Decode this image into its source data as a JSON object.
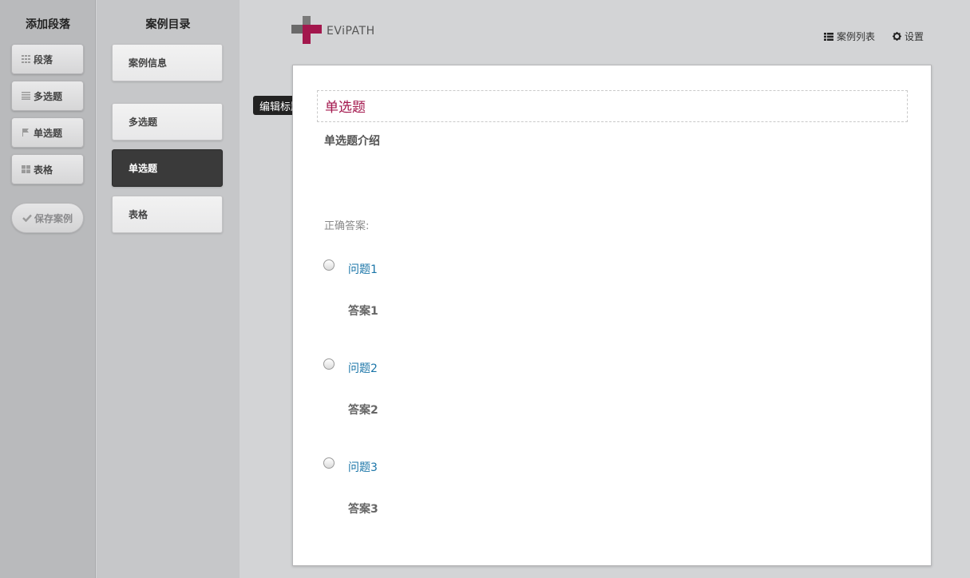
{
  "sidebar_add": {
    "title": "添加段落",
    "buttons": [
      {
        "label": "段落",
        "icon": "grid-icon"
      },
      {
        "label": "多选题",
        "icon": "list-icon"
      },
      {
        "label": "单选题",
        "icon": "flag-icon"
      },
      {
        "label": "表格",
        "icon": "table-icon"
      }
    ],
    "save_label": "保存案例",
    "save_icon": "check-icon"
  },
  "catalog": {
    "title": "案例目录",
    "items": [
      {
        "label": "案例信息",
        "active": false
      },
      {
        "label": "多选题",
        "active": false
      },
      {
        "label": "单选题",
        "active": true
      },
      {
        "label": "表格",
        "active": false
      }
    ]
  },
  "header": {
    "brand": "EViPATH",
    "nav": [
      {
        "label": "案例列表",
        "icon": "list-icon"
      },
      {
        "label": "设置",
        "icon": "gear-icon"
      }
    ]
  },
  "editor": {
    "tooltip": "编辑标题",
    "title": "单选题",
    "intro": "单选题介绍",
    "answer_label": "正确答案:",
    "questions": [
      {
        "question": "问题1",
        "answer": "答案1"
      },
      {
        "question": "问题2",
        "answer": "答案2"
      },
      {
        "question": "问题3",
        "answer": "答案3"
      }
    ]
  },
  "colors": {
    "title_accent": "#a3174d",
    "question_link": "#1a75a8",
    "active_item_bg": "#3a3a3a"
  }
}
